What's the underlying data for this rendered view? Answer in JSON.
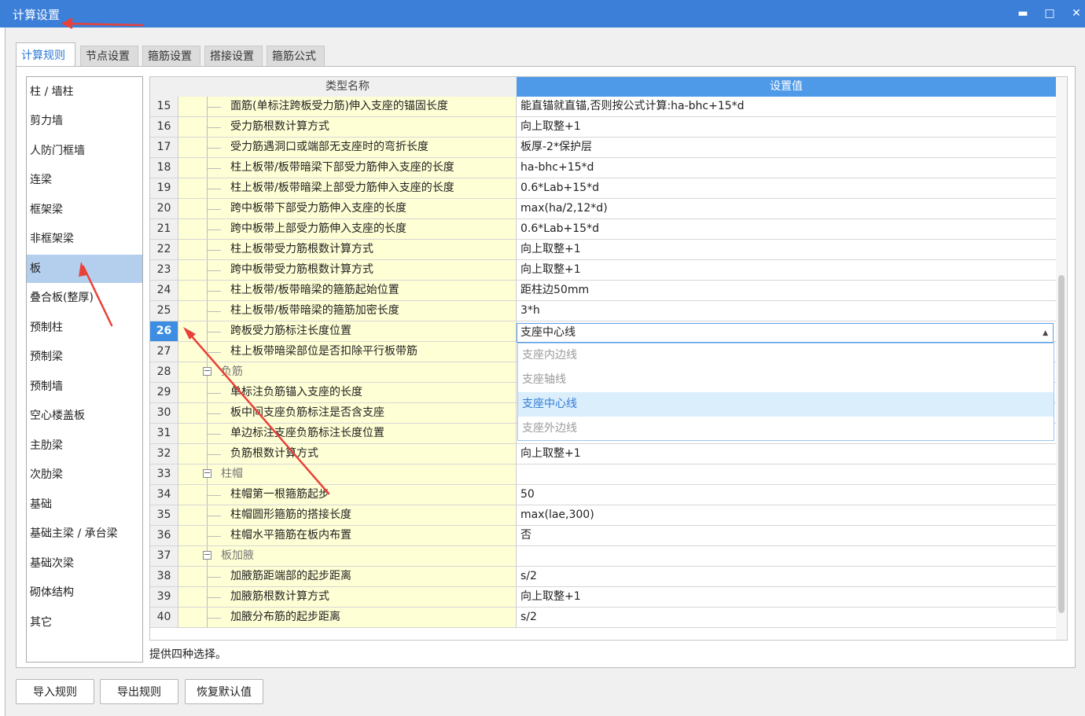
{
  "window": {
    "title": "计算设置",
    "minimize_icon": "minimize-icon",
    "maximize_icon": "maximize-icon",
    "close_icon": "close-icon"
  },
  "tabs": [
    {
      "label": "计算规则",
      "active": true
    },
    {
      "label": "节点设置",
      "active": false
    },
    {
      "label": "箍筋设置",
      "active": false
    },
    {
      "label": "搭接设置",
      "active": false
    },
    {
      "label": "箍筋公式",
      "active": false
    }
  ],
  "categories": [
    {
      "label": "柱 / 墙柱"
    },
    {
      "label": "剪力墙"
    },
    {
      "label": "人防门框墙"
    },
    {
      "label": "连梁"
    },
    {
      "label": "框架梁"
    },
    {
      "label": "非框架梁"
    },
    {
      "label": "板",
      "selected": true
    },
    {
      "label": "叠合板(整厚)"
    },
    {
      "label": "预制柱"
    },
    {
      "label": "预制梁"
    },
    {
      "label": "预制墙"
    },
    {
      "label": "空心楼盖板"
    },
    {
      "label": "主肋梁"
    },
    {
      "label": "次肋梁"
    },
    {
      "label": "基础"
    },
    {
      "label": "基础主梁 / 承台梁"
    },
    {
      "label": "基础次梁"
    },
    {
      "label": "砌体结构"
    },
    {
      "label": "其它"
    }
  ],
  "grid": {
    "headers": {
      "name": "类型名称",
      "value": "设置值"
    },
    "rows": [
      {
        "index": "15",
        "name": "面筋(单标注跨板受力筋)伸入支座的锚固长度",
        "value": "能直锚就直锚,否则按公式计算:ha-bhc+15*d"
      },
      {
        "index": "16",
        "name": "受力筋根数计算方式",
        "value": "向上取整+1"
      },
      {
        "index": "17",
        "name": "受力筋遇洞口或端部无支座时的弯折长度",
        "value": "板厚-2*保护层"
      },
      {
        "index": "18",
        "name": "柱上板带/板带暗梁下部受力筋伸入支座的长度",
        "value": "ha-bhc+15*d"
      },
      {
        "index": "19",
        "name": "柱上板带/板带暗梁上部受力筋伸入支座的长度",
        "value": "0.6*Lab+15*d"
      },
      {
        "index": "20",
        "name": "跨中板带下部受力筋伸入支座的长度",
        "value": "max(ha/2,12*d)"
      },
      {
        "index": "21",
        "name": "跨中板带上部受力筋伸入支座的长度",
        "value": "0.6*Lab+15*d"
      },
      {
        "index": "22",
        "name": "柱上板带受力筋根数计算方式",
        "value": "向上取整+1"
      },
      {
        "index": "23",
        "name": "跨中板带受力筋根数计算方式",
        "value": "向上取整+1"
      },
      {
        "index": "24",
        "name": "柱上板带/板带暗梁的箍筋起始位置",
        "value": "距柱边50mm"
      },
      {
        "index": "25",
        "name": "柱上板带/板带暗梁的箍筋加密长度",
        "value": "3*h"
      },
      {
        "index": "26",
        "name": "跨板受力筋标注长度位置",
        "value": "",
        "current": true
      },
      {
        "index": "27",
        "name": "柱上板带暗梁部位是否扣除平行板带筋",
        "value": ""
      },
      {
        "index": "28",
        "name": "负筋",
        "value": "",
        "group": true
      },
      {
        "index": "29",
        "name": "单标注负筋锚入支座的长度",
        "value": ""
      },
      {
        "index": "30",
        "name": "板中间支座负筋标注是否含支座",
        "value": ""
      },
      {
        "index": "31",
        "name": "单边标注支座负筋标注长度位置",
        "value": ""
      },
      {
        "index": "32",
        "name": "负筋根数计算方式",
        "value": "向上取整+1"
      },
      {
        "index": "33",
        "name": "柱帽",
        "value": "",
        "group": true
      },
      {
        "index": "34",
        "name": "柱帽第一根箍筋起步",
        "value": "50"
      },
      {
        "index": "35",
        "name": "柱帽圆形箍筋的搭接长度",
        "value": "max(lae,300)"
      },
      {
        "index": "36",
        "name": "柱帽水平箍筋在板内布置",
        "value": "否"
      },
      {
        "index": "37",
        "name": "板加腋",
        "value": "",
        "group": true
      },
      {
        "index": "38",
        "name": "加腋筋距端部的起步距离",
        "value": "s/2"
      },
      {
        "index": "39",
        "name": "加腋筋根数计算方式",
        "value": "向上取整+1"
      },
      {
        "index": "40",
        "name": "加腋分布筋的起步距离",
        "value": "s/2"
      }
    ]
  },
  "combo": {
    "value": "支座中心线",
    "caret_icon": "caret-up-icon",
    "options": [
      {
        "label": "支座内边线"
      },
      {
        "label": "支座轴线"
      },
      {
        "label": "支座中心线",
        "selected": true
      },
      {
        "label": "支座外边线"
      }
    ]
  },
  "hint": "提供四种选择。",
  "buttons": {
    "import": "导入规则",
    "export": "导出规则",
    "restore": "恢复默认值"
  },
  "colors": {
    "title_bar": "#3c7fd8",
    "header_value": "#4e9ae8",
    "name_cell": "#ffffd6",
    "selected_category": "#b4cfee",
    "current_index": "#3d8ee3",
    "annotation_arrow": "#e8413a"
  }
}
